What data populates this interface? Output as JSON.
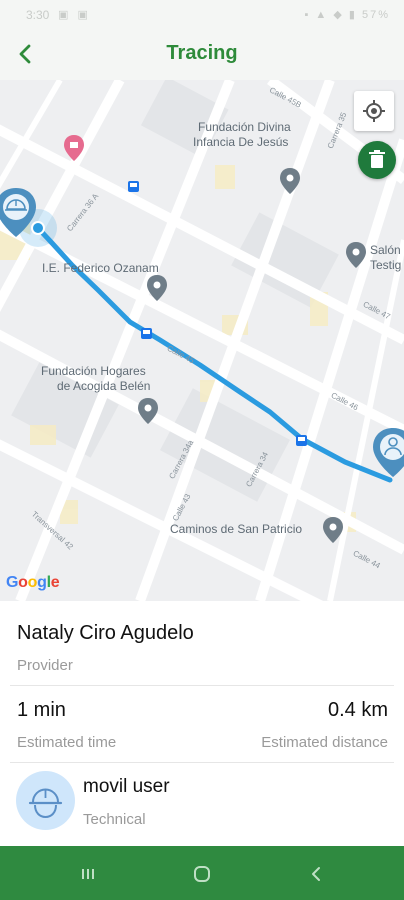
{
  "status_bar": {
    "time": "3:30",
    "left_icons": "▣ ▣",
    "right_icons": "▪ ▲ ◆ ▮ 57%"
  },
  "app_bar": {
    "title": "Tracing",
    "back_icon": "chevron-left-icon"
  },
  "map": {
    "places": [
      "Fundación Divina",
      "Infancia De Jesús",
      "I.E. Federico Ozanam",
      "Fundación Hogares",
      "de Acogida Belén",
      "Caminos de San Patricio",
      "Salón",
      "Testig"
    ],
    "streets": [
      "Calle 45B",
      "Carrera 35",
      "Carrera 36 A",
      "Calle 47",
      "Calle 45",
      "Calle 46",
      "Carrera 34a",
      "Carrera 34",
      "Calle 43",
      "Transversal 42",
      "Calle 44"
    ],
    "route_color": "#2b9be0",
    "attribution": "Google",
    "locate_icon": "my-location-icon",
    "delete_icon": "trash-icon"
  },
  "provider": {
    "name": "Nataly Ciro Agudelo",
    "role": "Provider"
  },
  "trip": {
    "time_value": "1 min",
    "time_label": "Estimated time",
    "distance_value": "0.4 km",
    "distance_label": "Estimated distance"
  },
  "user": {
    "name": "movil user",
    "role": "Technical",
    "avatar_icon": "hard-hat-worker-icon"
  },
  "theme": {
    "primary": "#2e8b3a",
    "nav_bar": "#2f8a40",
    "delete_button": "#1f7a3c"
  },
  "nav": {
    "recents_icon": "recents-icon",
    "home_icon": "home-icon",
    "back_icon": "back-icon"
  }
}
